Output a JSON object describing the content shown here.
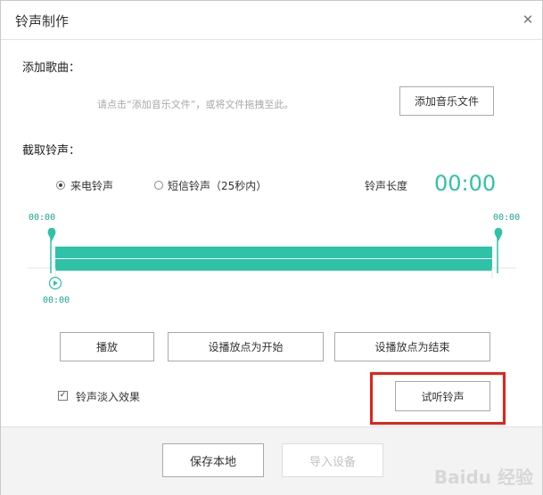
{
  "window": {
    "title": "铃声制作"
  },
  "add_song": {
    "label": "添加歌曲：",
    "hint": "请点击“添加音乐文件”，或将文件拖拽至此。",
    "button_label": "添加音乐文件"
  },
  "clip": {
    "label": "截取铃声：",
    "options": [
      {
        "label": "来电铃声",
        "checked": true
      },
      {
        "label": "短信铃声（25秒内）",
        "checked": false
      }
    ],
    "length_label": "铃声长度",
    "length_value": "00:00",
    "start_time": "00:00",
    "end_time": "00:00",
    "play_head_time": "00:00"
  },
  "controls": {
    "play": "播放",
    "set_start": "设播放点为开始",
    "set_end": "设播放点为结束"
  },
  "fade": {
    "label": "铃声淡入效果",
    "checked": true
  },
  "preview_button": "试听铃声",
  "footer": {
    "save_local": "保存本地",
    "import_device": "导入设备"
  },
  "watermark_text": "Baidu 经验",
  "colors": {
    "accent": "#2ec2a7",
    "highlight": "#e2231a"
  }
}
